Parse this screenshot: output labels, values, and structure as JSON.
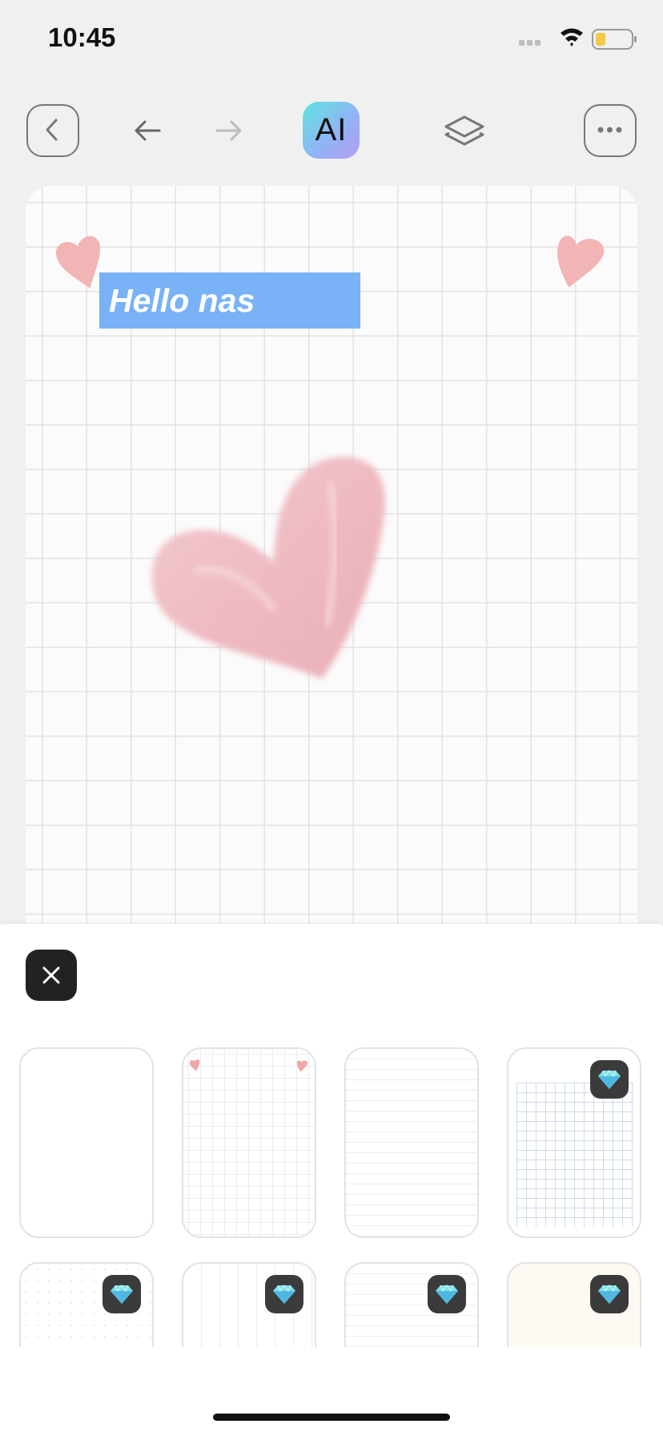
{
  "status_bar": {
    "time": "10:45",
    "battery_color": "#f2c94c"
  },
  "toolbar": {
    "ai_label": "AI",
    "icons": [
      "back-chevron-icon",
      "undo-arrow-icon",
      "redo-arrow-icon",
      "ai-icon",
      "layers-icon",
      "more-icon"
    ]
  },
  "canvas": {
    "text_box": "Hello nas",
    "text_box_color": "#79b2f6",
    "heart_color": "#f2b5b5"
  },
  "sheet": {
    "close_icon": "close-icon",
    "templates": [
      {
        "name": "blank",
        "premium": false
      },
      {
        "name": "hearts-dashed-grid",
        "premium": false
      },
      {
        "name": "lined",
        "premium": false
      },
      {
        "name": "blue-grid",
        "premium": true
      },
      {
        "name": "dotted",
        "premium": true
      },
      {
        "name": "dashed-columns",
        "premium": true
      },
      {
        "name": "faint-lined",
        "premium": true
      },
      {
        "name": "cream",
        "premium": true
      }
    ]
  }
}
